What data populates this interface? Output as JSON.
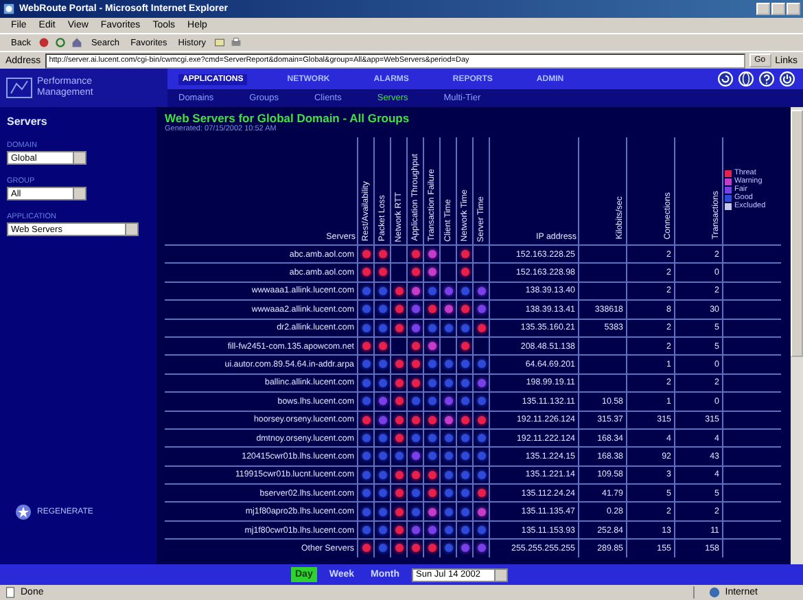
{
  "browser": {
    "title": "WebRoute Portal - Microsoft Internet Explorer",
    "menu": [
      "File",
      "Edit",
      "View",
      "Favorites",
      "Tools",
      "Help"
    ],
    "toolbar": [
      "Back",
      "Search",
      "Favorites",
      "History"
    ],
    "address_label": "Address",
    "url": "http://server.ai.lucent.com/cgi-bin/cwmcgi.exe?cmd=ServerReport&domain=Global&group=All&app=WebServers&period=Day",
    "go": "Go",
    "links": "Links"
  },
  "app": {
    "logo": [
      "Performance",
      "Management"
    ],
    "nav": [
      {
        "label": "APPLICATIONS",
        "selected": true
      },
      {
        "label": "NETWORK",
        "selected": false
      },
      {
        "label": "ALARMS",
        "selected": false
      },
      {
        "label": "REPORTS",
        "selected": false
      },
      {
        "label": "ADMIN",
        "selected": false
      }
    ],
    "subnav": [
      {
        "label": "Domains",
        "selected": false
      },
      {
        "label": "Groups",
        "selected": false
      },
      {
        "label": "Clients",
        "selected": false
      },
      {
        "label": "Servers",
        "selected": true
      },
      {
        "label": "Multi-Tier",
        "selected": false
      }
    ]
  },
  "sidebar": {
    "heading": "Servers",
    "filters": [
      {
        "label": "DOMAIN",
        "value": "Global"
      },
      {
        "label": "GROUP",
        "value": "All"
      },
      {
        "label": "APPLICATION",
        "value": "Web Servers"
      }
    ],
    "regenerate": "REGENERATE"
  },
  "report": {
    "title": "Web Servers for Global Domain - All Groups",
    "generated": "Generated: 07/15/2002 10:52 AM",
    "columns": {
      "name": "Servers",
      "metrics": [
        "Rest/Availability",
        "Packet Loss",
        "Network RTT",
        "Application Throughput",
        "Transaction Failure",
        "Client Time",
        "Network Time",
        "Server Time"
      ],
      "ip": "IP address",
      "kbps": "Kilobits/sec",
      "connections": "Connections",
      "transactions": "Transactions"
    },
    "legend": [
      {
        "label": "Threat",
        "color": "#e8204c"
      },
      {
        "label": "Warning",
        "color": "#c43cc8"
      },
      {
        "label": "Fair",
        "color": "#7a40e8"
      },
      {
        "label": "Good",
        "color": "#2f4ad8"
      },
      {
        "label": "Excluded",
        "color": "#c8c8e8"
      }
    ],
    "rows": [
      {
        "name": "abc.amb.aol.com",
        "cells": [
          {
            "dot": true,
            "color": "#e8204c"
          },
          {
            "dot": true,
            "color": "#e8204c"
          },
          {
            "dot": false
          },
          {
            "dot": true,
            "color": "#e8204c"
          },
          {
            "dot": true,
            "color": "#c43cc8"
          },
          {
            "dot": false
          },
          {
            "dot": true,
            "color": "#e8204c"
          },
          {
            "dot": false
          }
        ],
        "ip": "152.163.228.25",
        "connections": "2",
        "transactions": "2"
      },
      {
        "name": "abc.amb.aol.com",
        "cells": [
          {
            "dot": true,
            "color": "#e8204c"
          },
          {
            "dot": true,
            "color": "#e8204c"
          },
          {
            "dot": false
          },
          {
            "dot": true,
            "color": "#e8204c"
          },
          {
            "dot": true,
            "color": "#c43cc8"
          },
          {
            "dot": false
          },
          {
            "dot": true,
            "color": "#e8204c"
          },
          {
            "dot": false
          }
        ],
        "ip": "152.163.228.98",
        "connections": "2",
        "transactions": "0"
      },
      {
        "name": "wwwaaa1.allink.lucent.com",
        "cells": [
          {
            "dot": true,
            "color": "#2f4ad8"
          },
          {
            "dot": true,
            "color": "#2f4ad8"
          },
          {
            "dot": true,
            "color": "#e8204c"
          },
          {
            "dot": true,
            "color": "#c43cc8"
          },
          {
            "dot": true,
            "color": "#2f4ad8"
          },
          {
            "dot": true,
            "color": "#7a40e8"
          },
          {
            "dot": true,
            "color": "#2f4ad8"
          },
          {
            "dot": true,
            "color": "#7a40e8"
          }
        ],
        "ip": "138.39.13.40",
        "connections": "2",
        "transactions": "2"
      },
      {
        "name": "wwwaaa2.allink.lucent.com",
        "cells": [
          {
            "dot": true,
            "color": "#2f4ad8"
          },
          {
            "dot": true,
            "color": "#2f4ad8"
          },
          {
            "dot": true,
            "color": "#e8204c"
          },
          {
            "dot": true,
            "color": "#7a40e8"
          },
          {
            "dot": true,
            "color": "#e8204c"
          },
          {
            "dot": true,
            "color": "#c43cc8"
          },
          {
            "dot": true,
            "color": "#e8204c"
          },
          {
            "dot": true,
            "color": "#7a40e8"
          }
        ],
        "ip": "138.39.13.41",
        "kbps": "338618",
        "connections": "8",
        "transactions": "30"
      },
      {
        "name": "dr2.allink.lucent.com",
        "cells": [
          {
            "dot": true,
            "color": "#2f4ad8"
          },
          {
            "dot": true,
            "color": "#2f4ad8"
          },
          {
            "dot": true,
            "color": "#e8204c"
          },
          {
            "dot": true,
            "color": "#7a40e8"
          },
          {
            "dot": true,
            "color": "#2f4ad8"
          },
          {
            "dot": true,
            "color": "#2f4ad8"
          },
          {
            "dot": true,
            "color": "#2f4ad8"
          },
          {
            "dot": true,
            "color": "#e8204c"
          }
        ],
        "ip": "135.35.160.21",
        "kbps": "5383",
        "connections": "2",
        "transactions": "5"
      },
      {
        "name": "fill-fw2451-com.135.apowcom.net",
        "cells": [
          {
            "dot": true,
            "color": "#e8204c"
          },
          {
            "dot": true,
            "color": "#e8204c"
          },
          {
            "dot": false
          },
          {
            "dot": true,
            "color": "#e8204c"
          },
          {
            "dot": true,
            "color": "#c43cc8"
          },
          {
            "dot": false
          },
          {
            "dot": true,
            "color": "#e8204c"
          },
          {
            "dot": false
          }
        ],
        "ip": "208.48.51.138",
        "connections": "2",
        "transactions": "5"
      },
      {
        "name": "ui.autor.com.89.54.64.in-addr.arpa",
        "cells": [
          {
            "dot": true,
            "color": "#2f4ad8"
          },
          {
            "dot": true,
            "color": "#2f4ad8"
          },
          {
            "dot": true,
            "color": "#e8204c"
          },
          {
            "dot": true,
            "color": "#e8204c"
          },
          {
            "dot": true,
            "color": "#2f4ad8"
          },
          {
            "dot": true,
            "color": "#2f4ad8"
          },
          {
            "dot": true,
            "color": "#2f4ad8"
          },
          {
            "dot": true,
            "color": "#2f4ad8"
          }
        ],
        "ip": "64.64.69.201",
        "connections": "1",
        "transactions": "0"
      },
      {
        "name": "ballinc.allink.lucent.com",
        "cells": [
          {
            "dot": true,
            "color": "#2f4ad8"
          },
          {
            "dot": true,
            "color": "#2f4ad8"
          },
          {
            "dot": true,
            "color": "#e8204c"
          },
          {
            "dot": true,
            "color": "#e8204c"
          },
          {
            "dot": true,
            "color": "#2f4ad8"
          },
          {
            "dot": true,
            "color": "#2f4ad8"
          },
          {
            "dot": true,
            "color": "#2f4ad8"
          },
          {
            "dot": true,
            "color": "#7a40e8"
          }
        ],
        "ip": "198.99.19.11",
        "connections": "2",
        "transactions": "2"
      },
      {
        "name": "bows.lhs.lucent.com",
        "cells": [
          {
            "dot": true,
            "color": "#2f4ad8"
          },
          {
            "dot": true,
            "color": "#7a40e8"
          },
          {
            "dot": true,
            "color": "#e8204c"
          },
          {
            "dot": true,
            "color": "#2f4ad8"
          },
          {
            "dot": true,
            "color": "#2f4ad8"
          },
          {
            "dot": true,
            "color": "#7a40e8"
          },
          {
            "dot": true,
            "color": "#2f4ad8"
          },
          {
            "dot": true,
            "color": "#2f4ad8"
          }
        ],
        "ip": "135.11.132.11",
        "kbps": "10.58",
        "connections": "1",
        "transactions": "0"
      },
      {
        "name": "hoorsey.orseny.lucent.com",
        "cells": [
          {
            "dot": true,
            "color": "#e8204c"
          },
          {
            "dot": true,
            "color": "#7a40e8"
          },
          {
            "dot": true,
            "color": "#e8204c"
          },
          {
            "dot": true,
            "color": "#e8204c"
          },
          {
            "dot": true,
            "color": "#e8204c"
          },
          {
            "dot": true,
            "color": "#c43cc8"
          },
          {
            "dot": true,
            "color": "#e8204c"
          },
          {
            "dot": true,
            "color": "#e8204c"
          }
        ],
        "ip": "192.11.226.124",
        "kbps": "315.37",
        "connections": "315",
        "transactions": "315"
      },
      {
        "name": "dmtnoy.orseny.lucent.com",
        "cells": [
          {
            "dot": true,
            "color": "#2f4ad8"
          },
          {
            "dot": true,
            "color": "#2f4ad8"
          },
          {
            "dot": true,
            "color": "#e8204c"
          },
          {
            "dot": true,
            "color": "#2f4ad8"
          },
          {
            "dot": true,
            "color": "#2f4ad8"
          },
          {
            "dot": true,
            "color": "#2f4ad8"
          },
          {
            "dot": true,
            "color": "#2f4ad8"
          },
          {
            "dot": true,
            "color": "#2f4ad8"
          }
        ],
        "ip": "192.11.222.124",
        "kbps": "168.34",
        "connections": "4",
        "transactions": "4"
      },
      {
        "name": "120415cwr01b.lhs.lucent.com",
        "cells": [
          {
            "dot": true,
            "color": "#2f4ad8"
          },
          {
            "dot": true,
            "color": "#2f4ad8"
          },
          {
            "dot": true,
            "color": "#2f4ad8"
          },
          {
            "dot": true,
            "color": "#7a40e8"
          },
          {
            "dot": true,
            "color": "#2f4ad8"
          },
          {
            "dot": true,
            "color": "#2f4ad8"
          },
          {
            "dot": true,
            "color": "#2f4ad8"
          },
          {
            "dot": true,
            "color": "#2f4ad8"
          }
        ],
        "ip": "135.1.224.15",
        "kbps": "168.38",
        "connections": "92",
        "transactions": "43"
      },
      {
        "name": "119915cwr01b.lucnt.lucent.com",
        "cells": [
          {
            "dot": true,
            "color": "#2f4ad8"
          },
          {
            "dot": true,
            "color": "#2f4ad8"
          },
          {
            "dot": true,
            "color": "#e8204c"
          },
          {
            "dot": true,
            "color": "#e8204c"
          },
          {
            "dot": true,
            "color": "#e8204c"
          },
          {
            "dot": true,
            "color": "#2f4ad8"
          },
          {
            "dot": true,
            "color": "#2f4ad8"
          },
          {
            "dot": true,
            "color": "#2f4ad8"
          }
        ],
        "ip": "135.1.221.14",
        "kbps": "109.58",
        "connections": "3",
        "transactions": "4"
      },
      {
        "name": "bserver02.lhs.lucent.com",
        "cells": [
          {
            "dot": true,
            "color": "#2f4ad8"
          },
          {
            "dot": true,
            "color": "#2f4ad8"
          },
          {
            "dot": true,
            "color": "#e8204c"
          },
          {
            "dot": true,
            "color": "#2f4ad8"
          },
          {
            "dot": true,
            "color": "#e8204c"
          },
          {
            "dot": true,
            "color": "#2f4ad8"
          },
          {
            "dot": true,
            "color": "#2f4ad8"
          },
          {
            "dot": true,
            "color": "#e8204c"
          }
        ],
        "ip": "135.112.24.24",
        "kbps": "41.79",
        "connections": "5",
        "transactions": "5"
      },
      {
        "name": "mj1f80apro2b.lhs.lucent.com",
        "cells": [
          {
            "dot": true,
            "color": "#2f4ad8"
          },
          {
            "dot": true,
            "color": "#2f4ad8"
          },
          {
            "dot": true,
            "color": "#e8204c"
          },
          {
            "dot": true,
            "color": "#2f4ad8"
          },
          {
            "dot": true,
            "color": "#c43cc8"
          },
          {
            "dot": true,
            "color": "#2f4ad8"
          },
          {
            "dot": true,
            "color": "#2f4ad8"
          },
          {
            "dot": true,
            "color": "#c43cc8"
          }
        ],
        "ip": "135.11.135.47",
        "kbps": "0.28",
        "connections": "2",
        "transactions": "2"
      },
      {
        "name": "mj1f80cwr01b.lhs.lucent.com",
        "cells": [
          {
            "dot": true,
            "color": "#2f4ad8"
          },
          {
            "dot": true,
            "color": "#2f4ad8"
          },
          {
            "dot": true,
            "color": "#e8204c"
          },
          {
            "dot": true,
            "color": "#7a40e8"
          },
          {
            "dot": true,
            "color": "#7a40e8"
          },
          {
            "dot": true,
            "color": "#2f4ad8"
          },
          {
            "dot": true,
            "color": "#2f4ad8"
          },
          {
            "dot": true,
            "color": "#2f4ad8"
          }
        ],
        "ip": "135.11.153.93",
        "kbps": "252.84",
        "connections": "13",
        "transactions": "11"
      },
      {
        "name": "Other Servers",
        "cells": [
          {
            "dot": true,
            "color": "#e8204c"
          },
          {
            "dot": true,
            "color": "#2f4ad8"
          },
          {
            "dot": true,
            "color": "#e8204c"
          },
          {
            "dot": true,
            "color": "#e8204c"
          },
          {
            "dot": true,
            "color": "#e8204c"
          },
          {
            "dot": true,
            "color": "#2f4ad8"
          },
          {
            "dot": true,
            "color": "#7a40e8"
          },
          {
            "dot": true,
            "color": "#7a40e8"
          }
        ],
        "ip": "255.255.255.255",
        "kbps": "289.85",
        "connections": "155",
        "transactions": "158"
      }
    ]
  },
  "footer": {
    "periods": [
      {
        "label": "Day",
        "selected": true
      },
      {
        "label": "Week",
        "selected": false
      },
      {
        "label": "Month",
        "selected": false
      }
    ],
    "date": "Sun Jul 14 2002"
  },
  "status_bar": {
    "text": "Done",
    "zone": "Internet"
  }
}
